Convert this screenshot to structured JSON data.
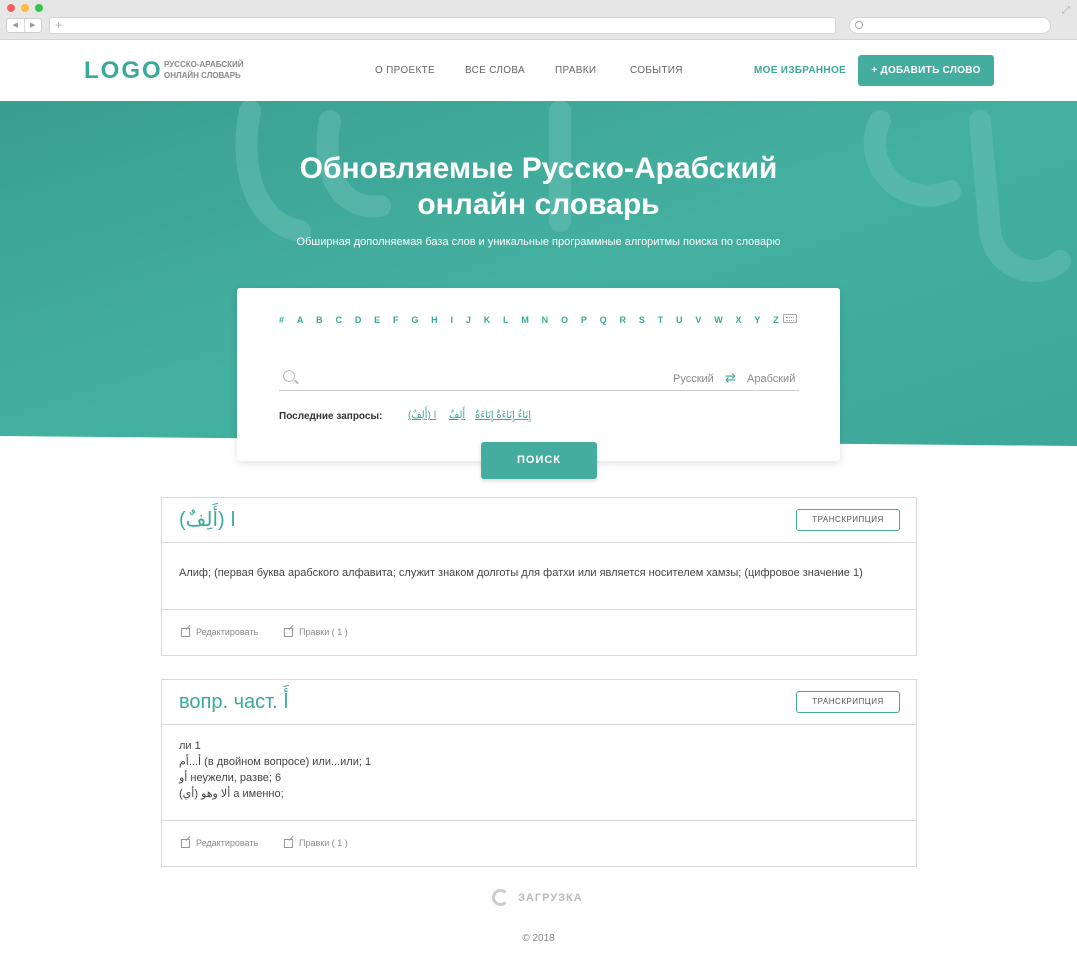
{
  "colors": {
    "accent": "#45ad9f",
    "accent_text": "#3aa99a",
    "hero_bg": "#40ad9d"
  },
  "header": {
    "logo": "LOGO",
    "logo_sub_line1": "РУССКО-АРАБСКИЙ",
    "logo_sub_line2": "ОНЛАЙН СЛОВАРЬ",
    "nav": [
      "О ПРОЕКТЕ",
      "ВСЕ СЛОВА",
      "ПРАВКИ",
      "СОБЫТИЯ"
    ],
    "favorites": "МОЕ ИЗБРАННОЕ",
    "add_word": "+ ДОБАВИТЬ СЛОВО"
  },
  "hero": {
    "title_line1": "Обновляемые Русско-Арабский",
    "title_line2": "онлайн словарь",
    "subtitle": "Обширная дополняемая база слов и уникальные программные алгоритмы поиска по словарю"
  },
  "search": {
    "letters": [
      "#",
      "A",
      "B",
      "C",
      "D",
      "E",
      "F",
      "G",
      "H",
      "I",
      "J",
      "K",
      "L",
      "M",
      "N",
      "O",
      "P",
      "Q",
      "R",
      "S",
      "T",
      "U",
      "V",
      "W",
      "X",
      "Y",
      "Z"
    ],
    "keyboard_icon": "keyboard-icon",
    "lang_from": "Русский",
    "lang_to": "Арабский",
    "recent_label": "Последние запросы:",
    "recent": [
      "ا (أَلِفٌ)",
      "أَلِفٌ",
      "إِنَاءٌ إِنَاءَةٌ إِنَاءَةٌ"
    ],
    "button": "ПОИСК"
  },
  "entries": [
    {
      "title": "ا (أَلِفٌ)",
      "transcription": "ТРАНСКРИПЦИЯ",
      "lines": [
        "Алиф; (первая буква арабского алфавита; служит знаком долготы для фатхи или является носителем хамзы; (цифровое значение 1)"
      ],
      "edit": "Редактировать",
      "edits": "Правки ( 1 )"
    },
    {
      "title": "вопр. част. أَ",
      "transcription": "ТРАНСКРИПЦИЯ",
      "lines": [
        "ли 1",
        "أ...أم (в двойном вопросе) или...или; 1",
        "أو неужели, разве; 6",
        "(أي) ألا وهو а именно;"
      ],
      "edit": "Редактировать",
      "edits": "Правки ( 1 )"
    }
  ],
  "loading": "ЗАГРУЗКА",
  "footer": "© 2018"
}
